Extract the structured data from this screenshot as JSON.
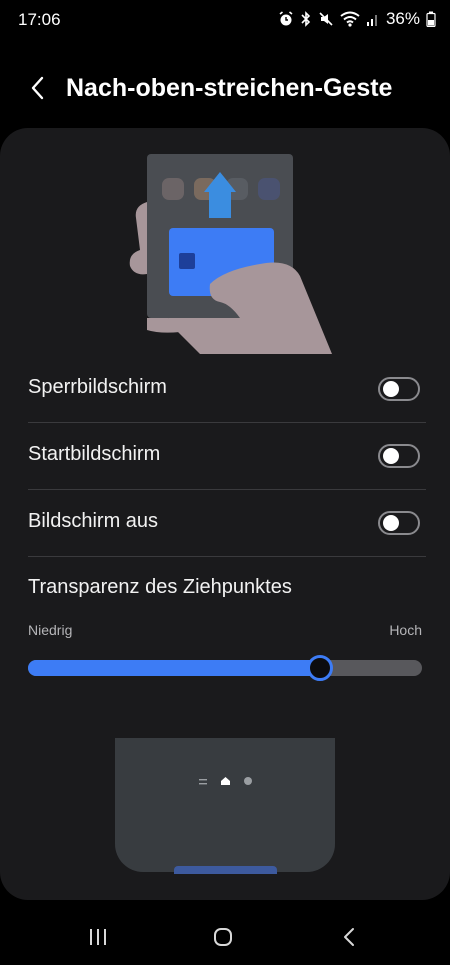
{
  "status_bar": {
    "time": "17:06",
    "battery_percent": "36%",
    "icons": [
      "alarm-icon",
      "bluetooth-icon",
      "mute-icon",
      "wifi-icon",
      "signal-icon",
      "battery-icon"
    ]
  },
  "header": {
    "title": "Nach-oben-streichen-Geste",
    "back_icon": "chevron-left-icon"
  },
  "settings": [
    {
      "label": "Sperrbildschirm",
      "enabled": false
    },
    {
      "label": "Startbildschirm",
      "enabled": false
    },
    {
      "label": "Bildschirm aus",
      "enabled": false
    }
  ],
  "transparency": {
    "title": "Transparenz des Ziehpunktes",
    "min_label": "Niedrig",
    "max_label": "Hoch",
    "value_fraction": 0.74
  },
  "nav_bar": {
    "buttons": [
      "recents-icon",
      "home-icon",
      "back-icon"
    ]
  },
  "colors": {
    "accent": "#3d7cf5",
    "card_background": "#1a1a1c",
    "page_background": "#000000"
  }
}
